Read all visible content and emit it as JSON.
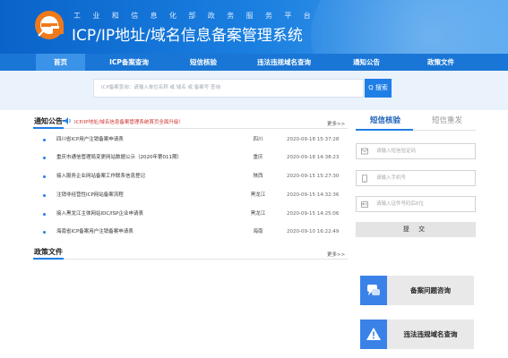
{
  "header": {
    "subtitle": "工业和信息化部政务服务平台",
    "title": "ICP/IP地址/域名信息备案管理系统"
  },
  "nav": {
    "items": [
      {
        "label": "首页",
        "active": true
      },
      {
        "label": "ICP备案查询",
        "active": false
      },
      {
        "label": "短信核验",
        "active": false
      },
      {
        "label": "违法违规域名查询",
        "active": false
      },
      {
        "label": "通知公告",
        "active": false
      },
      {
        "label": "政策文件",
        "active": false
      }
    ]
  },
  "search": {
    "placeholder": "ICP备案查询：请输入单位名称 或 域名 或 备案号 查询",
    "button_label": "Q 搜索"
  },
  "notice": {
    "title": "通知公告",
    "marquee": "ICP/IP地址/域名信息备案管理系统首页全面升级！",
    "more": "更多>>",
    "items": [
      {
        "title": "四川省ICP用户注销备案申请表",
        "province": "四川",
        "date": "2020-09-18 15:37:28"
      },
      {
        "title": "重庆市通信管理局变更网站数据公示（2020年第011期）",
        "province": "重庆",
        "date": "2020-09-18 14:38:23"
      },
      {
        "title": "接入服务企业网站备案工作联系信息登记",
        "province": "陕西",
        "date": "2020-09-15 15:27:30"
      },
      {
        "title": "注销非经营性ICP网站备案流程",
        "province": "黑龙江",
        "date": "2020-09-15 14:32:36"
      },
      {
        "title": "接入黑龙江主体网站IDC/ISP企业申请表",
        "province": "黑龙江",
        "date": "2020-09-15 14:25:06"
      },
      {
        "title": "海南省ICP备案用户注销备案申请表",
        "province": "海南",
        "date": "2020-09-10 16:22:49"
      }
    ]
  },
  "policy": {
    "title": "政策文件",
    "more": "更多>>"
  },
  "sms": {
    "tab_active": "短信核验",
    "tab_inactive": "短信重发",
    "fields": [
      {
        "placeholder": "请输入短信验证码",
        "icon": "message-icon"
      },
      {
        "placeholder": "请输入手机号",
        "icon": "phone-icon"
      },
      {
        "placeholder": "请输入证件号码后6位",
        "icon": "id-card-icon"
      }
    ],
    "submit_label": "提 交"
  },
  "cards": [
    {
      "label": "备案问题咨询",
      "icon": "chat-icon"
    },
    {
      "label": "违法违规域名查询",
      "icon": "warning-icon"
    }
  ],
  "colors": {
    "primary": "#1f7fe6",
    "nav": "#1a76d6",
    "alert": "#d03030",
    "logo_orange": "#f07a1a"
  }
}
